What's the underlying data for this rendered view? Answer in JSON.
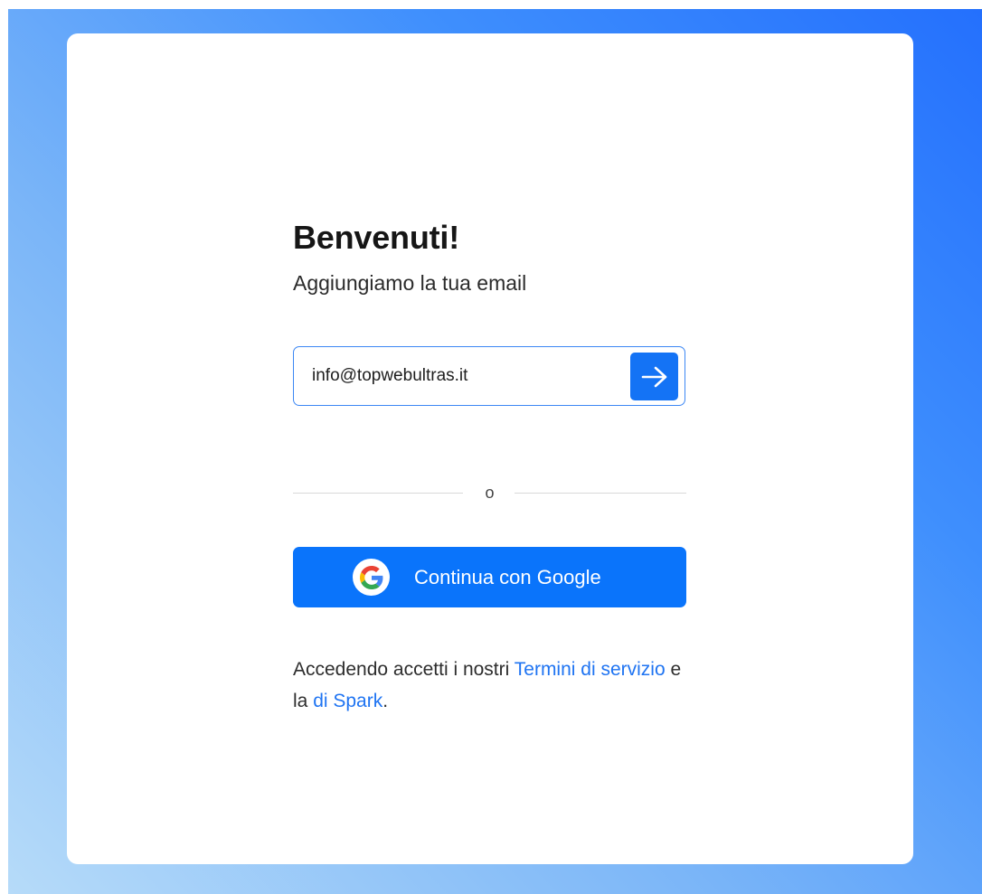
{
  "page": {
    "background_gradient": [
      "#2470fd",
      "#b6dbf9"
    ],
    "accent_color": "#0a74fb"
  },
  "login": {
    "title": "Benvenuti!",
    "subtitle": "Aggiungiamo la tua email",
    "email": {
      "value": "info@topwebultras.it",
      "submit_icon": "arrow-right-icon"
    },
    "divider_text": "o",
    "google_button": {
      "label": "Continua con Google",
      "icon": "google-logo-icon"
    },
    "terms": {
      "prefix": "Accedendo accetti i nostri ",
      "terms_link": "Termini di servizio",
      "middle": " e la ",
      "spark_link": "di Spark",
      "suffix": "."
    }
  }
}
